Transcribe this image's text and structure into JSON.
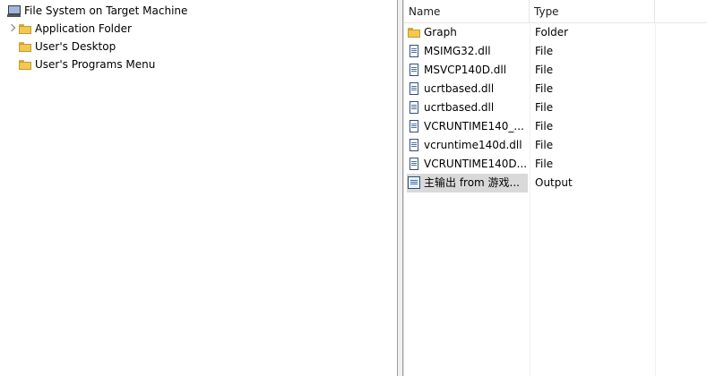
{
  "tree": {
    "root": {
      "label": "File System on Target Machine",
      "icon": "computer-icon"
    },
    "children": [
      {
        "label": "Application Folder",
        "icon": "folder-icon",
        "has_children": true
      },
      {
        "label": "User's Desktop",
        "icon": "folder-icon",
        "has_children": false
      },
      {
        "label": "User's Programs Menu",
        "icon": "folder-icon",
        "has_children": false
      }
    ]
  },
  "list": {
    "columns": [
      "Name",
      "Type"
    ],
    "rows": [
      {
        "name": "Graph",
        "type": "Folder",
        "icon": "folder-icon"
      },
      {
        "name": "MSIMG32.dll",
        "type": "File",
        "icon": "file-icon"
      },
      {
        "name": "MSVCP140D.dll",
        "type": "File",
        "icon": "file-icon"
      },
      {
        "name": "ucrtbased.dll",
        "type": "File",
        "icon": "file-icon"
      },
      {
        "name": "ucrtbased.dll",
        "type": "File",
        "icon": "file-icon"
      },
      {
        "name": "VCRUNTIME140_...",
        "type": "File",
        "icon": "file-icon"
      },
      {
        "name": "vcruntime140d.dll",
        "type": "File",
        "icon": "file-icon"
      },
      {
        "name": "VCRUNTIME140D...",
        "type": "File",
        "icon": "file-icon"
      },
      {
        "name": "主输出 from 游戏...",
        "type": "Output",
        "icon": "output-icon",
        "selected": true
      }
    ]
  }
}
